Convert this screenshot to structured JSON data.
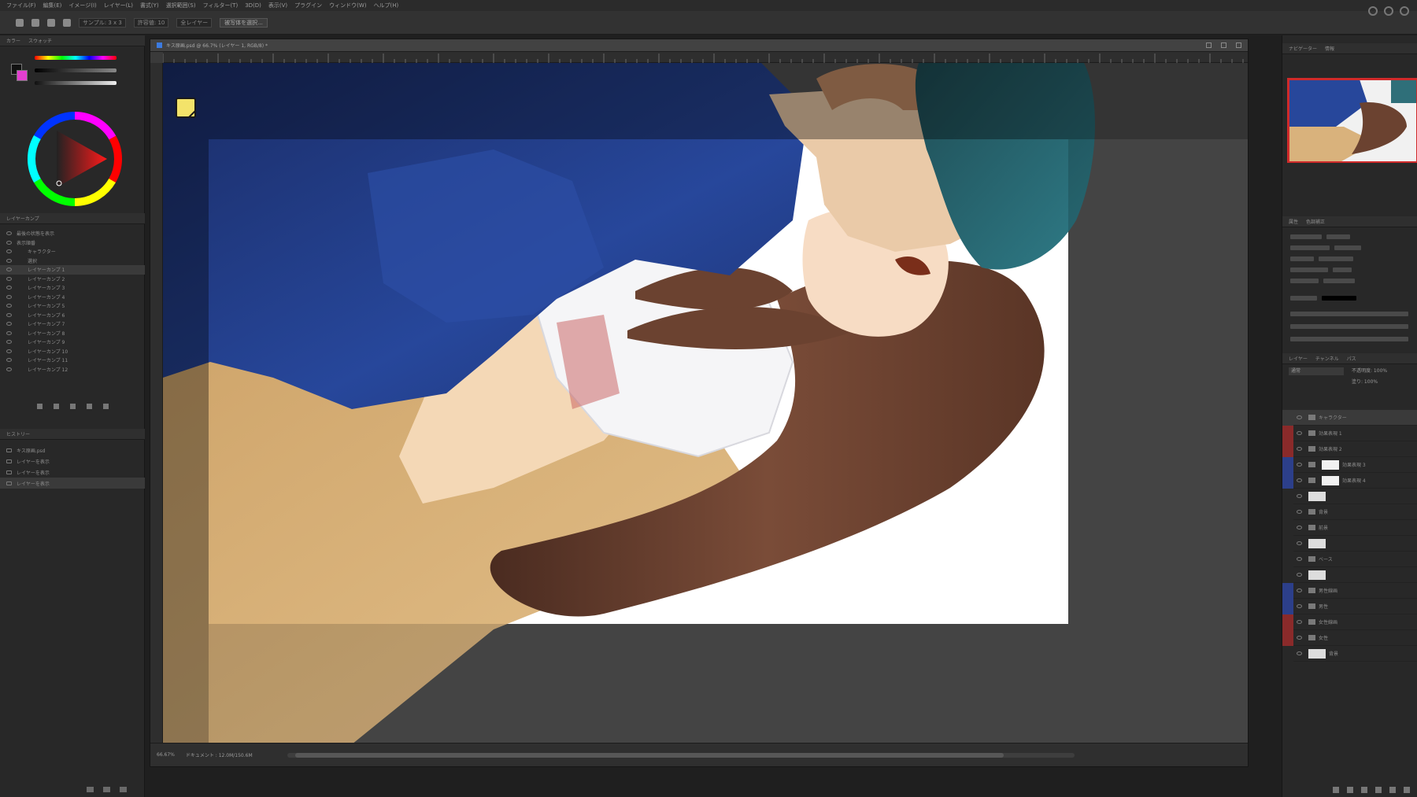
{
  "menubar": {
    "items": [
      "ファイル(F)",
      "編集(E)",
      "イメージ(I)",
      "レイヤー(L)",
      "書式(Y)",
      "選択範囲(S)",
      "フィルター(T)",
      "3D(D)",
      "表示(V)",
      "プラグイン",
      "ウィンドウ(W)",
      "ヘルプ(H)"
    ]
  },
  "options": {
    "sample_size_label": "サンプル: 3 x 3",
    "mode_label": "全レイヤー",
    "tolerance_label": "許容値: 10",
    "select_subject_button": "被写体を選択..."
  },
  "left_panels": {
    "color_tabs": [
      "カラー",
      "スウォッチ"
    ],
    "comp_tabs": [
      "レイヤーカンプ"
    ],
    "comp_items": [
      "最後の状態を表示",
      "表示順番",
      "キャラクター",
      "選択",
      "レイヤーカンプ 1",
      "レイヤーカンプ 2",
      "レイヤーカンプ 3",
      "レイヤーカンプ 4",
      "レイヤーカンプ 5",
      "レイヤーカンプ 6",
      "レイヤーカンプ 7",
      "レイヤーカンプ 8",
      "レイヤーカンプ 9",
      "レイヤーカンプ 10",
      "レイヤーカンプ 11",
      "レイヤーカンプ 12"
    ],
    "history_tabs": [
      "ヒストリー"
    ],
    "history_items": [
      "キス原画.psd",
      "レイヤーを表示",
      "レイヤーを表示",
      "レイヤーを表示"
    ]
  },
  "document": {
    "tab_title": "キス原画.psd @ 66.7% (レイヤー 1, RGB/8) *",
    "zoom": "66.67%",
    "doc_size": "ドキュメント : 12.0M/150.6M"
  },
  "right_panels": {
    "navigator_tabs": [
      "ナビゲーター",
      "情報"
    ],
    "properties_tabs": [
      "属性",
      "色調補正"
    ],
    "layer_tabs": [
      "レイヤー",
      "チャンネル",
      "パス"
    ],
    "blend_mode": "通常",
    "opacity_label": "不透明度: 100%",
    "fill_label": "塗り: 100%",
    "layers": [
      {
        "name": "キャラクター",
        "kind": "folder",
        "mark": "#3a3a3a"
      },
      {
        "name": "効果表現 1",
        "kind": "folder",
        "mark": "#8a2a2a"
      },
      {
        "name": "効果表現 2",
        "kind": "folder",
        "mark": "#8a2a2a"
      },
      {
        "name": "効果表現 3",
        "kind": "art",
        "mark": "#2c3f8a"
      },
      {
        "name": "効果表現 4",
        "kind": "art",
        "mark": "#2c3f8a"
      },
      {
        "name": "",
        "kind": "thumb",
        "mark": "#282828"
      },
      {
        "name": "背景",
        "kind": "folder",
        "mark": "#282828"
      },
      {
        "name": "前景",
        "kind": "folder",
        "mark": "#282828"
      },
      {
        "name": "",
        "kind": "thumb",
        "mark": "#282828"
      },
      {
        "name": "ベース",
        "kind": "folder",
        "mark": "#282828"
      },
      {
        "name": "",
        "kind": "thumb",
        "mark": "#282828"
      },
      {
        "name": "男性線画",
        "kind": "folder",
        "mark": "#2c3f8a"
      },
      {
        "name": "男性",
        "kind": "folder",
        "mark": "#2c3f8a"
      },
      {
        "name": "女性線画",
        "kind": "folder",
        "mark": "#8a2a2a"
      },
      {
        "name": "女性",
        "kind": "folder",
        "mark": "#8a2a2a"
      },
      {
        "name": "背景",
        "kind": "thumb",
        "mark": "#282828"
      }
    ]
  },
  "colors": {
    "accent_blue": "#2c3f8a",
    "accent_red": "#8a2a2a",
    "canvas_bg": "#ffffff"
  }
}
